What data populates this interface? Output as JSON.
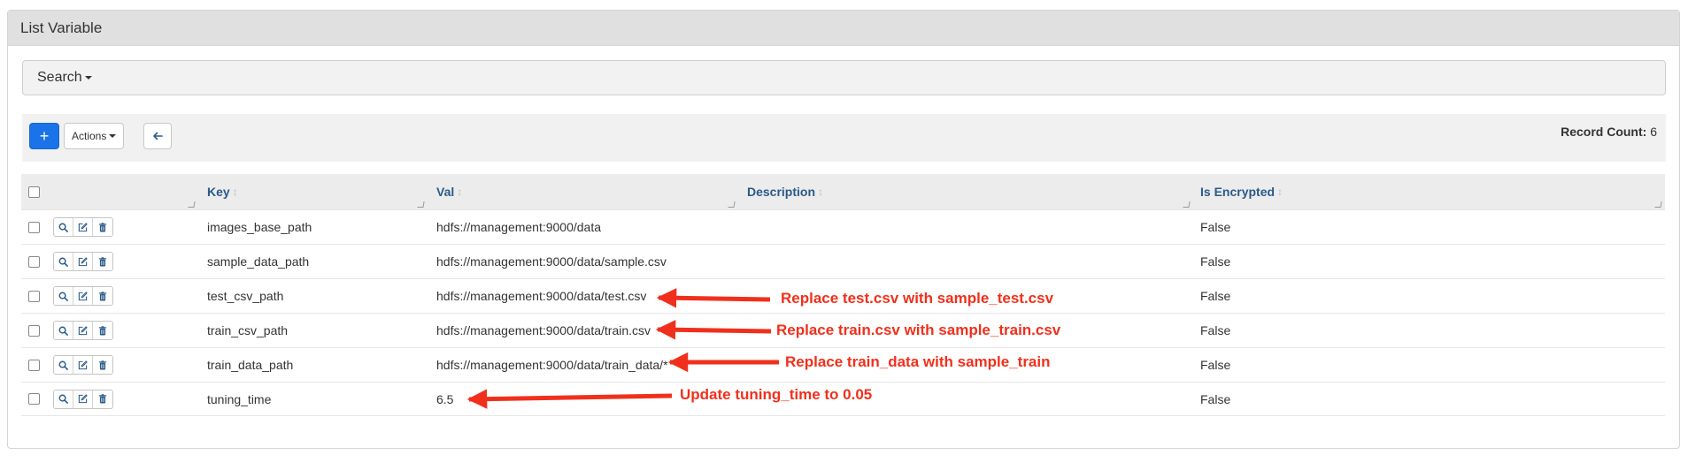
{
  "panel": {
    "title": "List Variable"
  },
  "search": {
    "label": "Search"
  },
  "toolbar": {
    "add_label": "+",
    "actions_label": "Actions",
    "record_count_label": "Record Count:",
    "record_count_value": "6"
  },
  "table": {
    "columns": [
      "Key",
      "Val",
      "Description",
      "Is Encrypted"
    ],
    "rows": [
      {
        "key": "images_base_path",
        "val": "hdfs://management:9000/data",
        "description": "",
        "encrypted": "False"
      },
      {
        "key": "sample_data_path",
        "val": "hdfs://management:9000/data/sample.csv",
        "description": "",
        "encrypted": "False"
      },
      {
        "key": "test_csv_path",
        "val": "hdfs://management:9000/data/test.csv",
        "description": "",
        "encrypted": "False"
      },
      {
        "key": "train_csv_path",
        "val": "hdfs://management:9000/data/train.csv",
        "description": "",
        "encrypted": "False"
      },
      {
        "key": "train_data_path",
        "val": "hdfs://management:9000/data/train_data/*",
        "description": "",
        "encrypted": "False"
      },
      {
        "key": "tuning_time",
        "val": "6.5",
        "description": "",
        "encrypted": "False"
      }
    ]
  },
  "annotations": [
    "Replace test.csv with sample_test.csv",
    "Replace train.csv with sample_train.csv",
    "Replace train_data with sample_train",
    "Update tuning_time to 0.05"
  ],
  "colors": {
    "accent": "#1a73e8",
    "annotation": "#f0301c",
    "header_text": "#2a5a8a"
  },
  "icons": [
    "search-icon",
    "edit-icon",
    "trash-icon",
    "arrow-left-icon",
    "sort-icon"
  ]
}
